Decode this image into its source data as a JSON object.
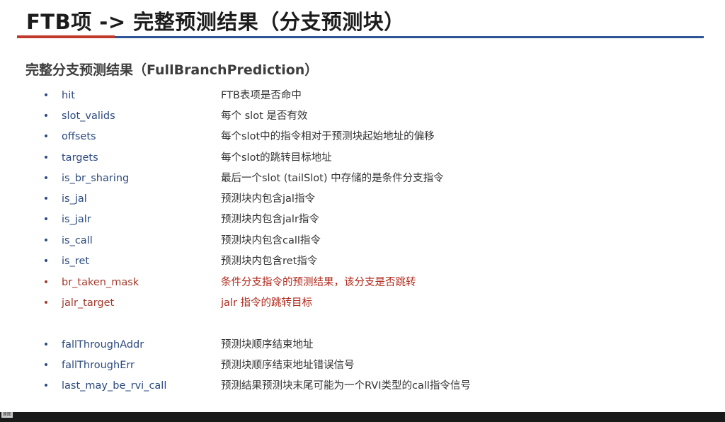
{
  "slide": {
    "title": "FTB项 -> 完整预测结果（分支预测块）",
    "heading": "完整分支预测结果（FullBranchPrediction）",
    "bullet_glyph": "•",
    "fields": [
      {
        "name": "hit",
        "desc": "FTB表项是否命中",
        "style": "normal"
      },
      {
        "name": "slot_valids",
        "desc": "每个 slot 是否有效",
        "style": "normal"
      },
      {
        "name": "offsets",
        "desc": "每个slot中的指令相对于预测块起始地址的偏移",
        "style": "normal"
      },
      {
        "name": "targets",
        "desc": "每个slot的跳转目标地址",
        "style": "normal"
      },
      {
        "name": "is_br_sharing",
        "desc": "最后一个slot (tailSlot) 中存储的是条件分支指令",
        "style": "normal"
      },
      {
        "name": "is_jal",
        "desc": "预测块内包含jal指令",
        "style": "normal"
      },
      {
        "name": "is_jalr",
        "desc": "预测块内包含jalr指令",
        "style": "normal"
      },
      {
        "name": "is_call",
        "desc": "预测块内包含call指令",
        "style": "normal"
      },
      {
        "name": "is_ret",
        "desc": "预测块内包含ret指令",
        "style": "normal"
      },
      {
        "name": "br_taken_mask",
        "desc": "条件分支指令的预测结果，该分支是否跳转",
        "style": "highlight"
      },
      {
        "name": "jalr_target",
        "desc": "jalr 指令的跳转目标",
        "style": "highlight"
      },
      {
        "name": "fallThroughAddr",
        "desc": "预测块顺序结束地址",
        "style": "normal"
      },
      {
        "name": "fallThroughErr",
        "desc": "预测块顺序结束地址错误信号",
        "style": "normal"
      },
      {
        "name": "last_may_be_rvi_call",
        "desc": "预测结果预测块末尾可能为一个RVI类型的call指令信号",
        "style": "normal"
      }
    ]
  },
  "corner_label": "原图",
  "colors": {
    "accent_red": "#c0392b",
    "accent_blue": "#2f5597",
    "field_blue": "#2b4a7e",
    "highlight_red": "#b0281b"
  }
}
